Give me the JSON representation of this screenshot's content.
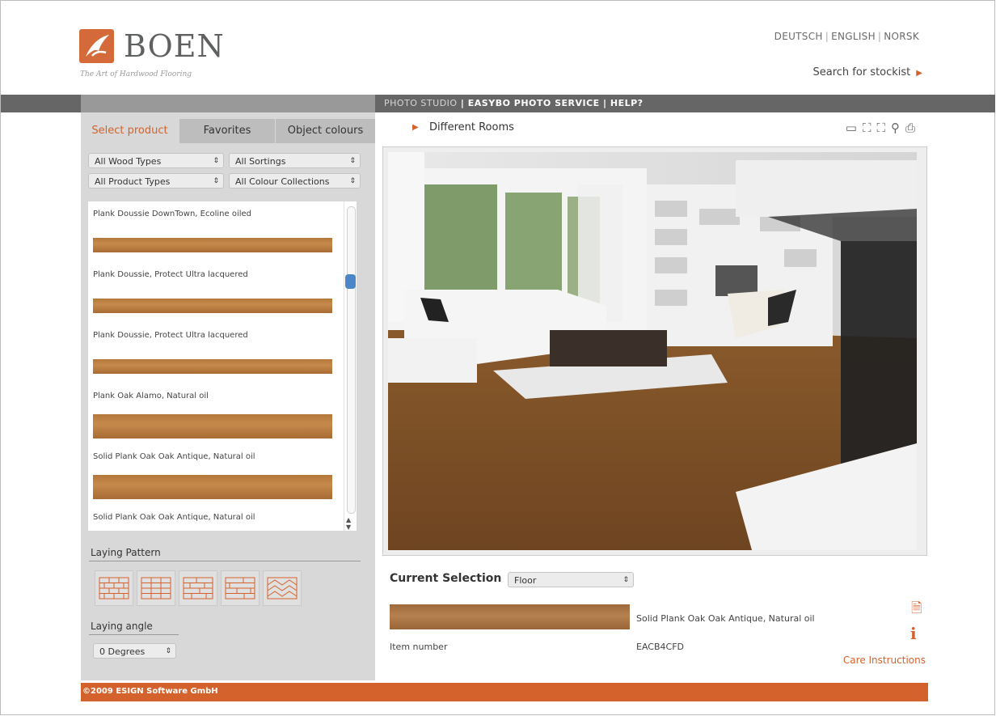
{
  "brand": {
    "name": "BOEN",
    "tagline": "The Art of Hardwood Flooring"
  },
  "languages": [
    "DEUTSCH",
    "ENGLISH",
    "NORSK"
  ],
  "stockist_link": "Search for stockist",
  "top_nav": {
    "photo_studio": "PHOTO STUDIO",
    "easybo": "EASYBO PHOTO SERVICE",
    "help": "HELP?",
    "separator": "|"
  },
  "tabs": [
    "Select product",
    "Favorites",
    "Object colours"
  ],
  "filters": {
    "wood_types": "All Wood Types",
    "sortings": "All Sortings",
    "product_types": "All Product Types",
    "colour_collections": "All Colour Collections"
  },
  "products": [
    "Plank Doussie DownTown, Ecoline oiled",
    "Plank Doussie, Protect Ultra lacquered",
    "Plank Doussie, Protect Ultra lacquered",
    "Plank Oak Alamo, Natural oil",
    "Solid Plank Oak Oak Antique, Natural oil",
    "Solid Plank Oak Oak Antique, Natural oil"
  ],
  "laying_pattern": {
    "label": "Laying Pattern"
  },
  "laying_angle": {
    "label": "Laying angle",
    "value": "0 Degrees"
  },
  "room_menu": "Different Rooms",
  "view_icons": [
    "monitor-icon",
    "expand-icon",
    "collapse-icon",
    "zoom-icon",
    "print-icon"
  ],
  "current_selection": {
    "label": "Current Selection",
    "surface": "Floor",
    "product_name": "Solid Plank Oak Oak Antique, Natural oil",
    "item_number_label": "Item number",
    "item_number": "EACB4CFD",
    "care_link": "Care Instructions"
  },
  "footer": "©2009 ESIGN Software GmbH",
  "colors": {
    "accent": "#d4622c",
    "bar": "#666666",
    "panel": "#d8d8d8"
  }
}
